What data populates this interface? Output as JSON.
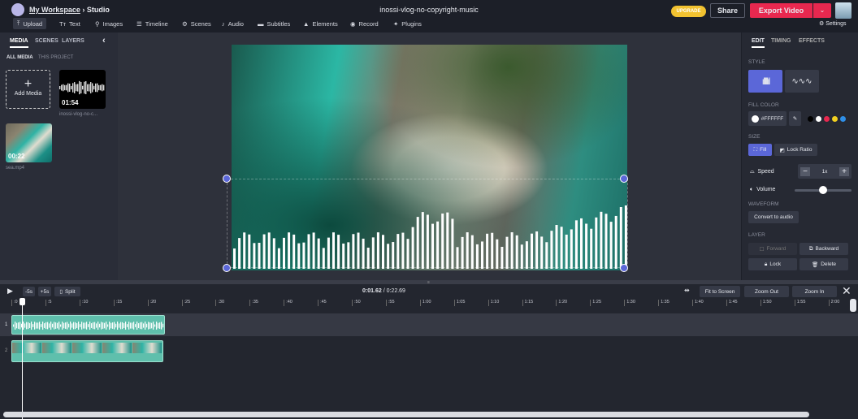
{
  "header": {
    "workspace": "My Workspace",
    "separator": "›",
    "section": "Studio",
    "project_title": "inossi-vlog-no-copyright-music",
    "upgrade": "UPGRADE",
    "share": "Share",
    "export": "Export Video",
    "settings": "Settings"
  },
  "toolbar": [
    {
      "label": "Upload",
      "icon": "upload-icon"
    },
    {
      "label": "Text",
      "icon": "text-icon"
    },
    {
      "label": "Images",
      "icon": "search-icon"
    },
    {
      "label": "Timeline",
      "icon": "timeline-icon"
    },
    {
      "label": "Scenes",
      "icon": "scenes-icon"
    },
    {
      "label": "Audio",
      "icon": "music-icon"
    },
    {
      "label": "Subtitles",
      "icon": "subtitles-icon"
    },
    {
      "label": "Elements",
      "icon": "shapes-icon"
    },
    {
      "label": "Record",
      "icon": "record-icon"
    },
    {
      "label": "Plugins",
      "icon": "plugin-icon"
    }
  ],
  "left": {
    "tabs": [
      "MEDIA",
      "SCENES",
      "LAYERS"
    ],
    "subtabs": [
      "ALL MEDIA",
      "THIS PROJECT"
    ],
    "add_media": "Add Media",
    "media": [
      {
        "duration": "01:54",
        "name": "inossi-vlog-no-c..."
      },
      {
        "duration": "00:22",
        "name": "sea.mp4"
      }
    ]
  },
  "right": {
    "tabs": [
      "EDIT",
      "TIMING",
      "EFFECTS"
    ],
    "style_label": "STYLE",
    "fill_color_label": "FILL COLOR",
    "fill_color": "#FFFFFF",
    "swatches": [
      "#000000",
      "#ffffff",
      "#e8284f",
      "#f2d020",
      "#2f8fe8"
    ],
    "size_label": "SIZE",
    "fill": "Fill",
    "lock_ratio": "Lock Ratio",
    "speed_label": "Speed",
    "speed": "1x",
    "volume_label": "Volume",
    "volume": 0.5,
    "waveform_label": "WAVEFORM",
    "convert": "Convert to audio",
    "layer_label": "LAYER",
    "forward": "Forward",
    "backward": "Backward",
    "lock": "Lock",
    "delete": "Delete"
  },
  "timeline": {
    "minus5": "-5s",
    "plus5": "+5s",
    "split": "Split",
    "current": "0:01.62",
    "total": "0:22.69",
    "fit": "Fit to Screen",
    "zoom_out": "Zoom Out",
    "zoom_in": "Zoom In",
    "ticks": [
      ":0",
      ":5",
      ":10",
      ":15",
      ":20",
      ":25",
      ":30",
      ":35",
      ":40",
      ":45",
      ":50",
      ":55",
      "1:00",
      "1:05",
      "1:10",
      "1:15",
      "1:20",
      "1:25",
      "1:30",
      "1:35",
      "1:40",
      "1:45",
      "1:50",
      "1:55",
      "2:00"
    ],
    "tracks": [
      "1",
      "2"
    ]
  },
  "colors": {
    "accent": "#5b67d8",
    "export": "#e8284f",
    "upgrade": "#f2c230",
    "clip": "#5fbfac"
  }
}
